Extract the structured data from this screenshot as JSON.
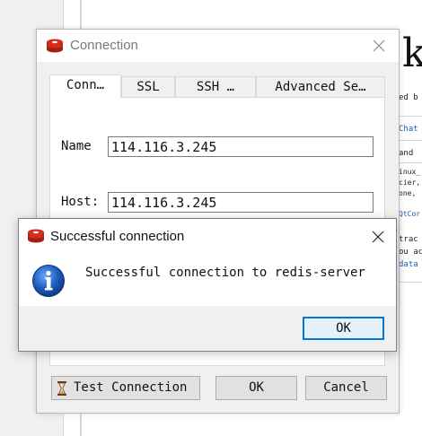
{
  "background": {
    "heading_fragment": "k",
    "lines": [
      {
        "text": "ed b",
        "link": false
      },
      {
        "text": "Chat",
        "link": true
      },
      {
        "text": " and",
        "link": false
      },
      {
        "text": "inux_",
        "link": false
      },
      {
        "text": "cier,",
        "link": false
      },
      {
        "text": "one,",
        "link": false
      },
      {
        "text": "QtCor",
        "link": true
      },
      {
        "text": "trac",
        "link": false
      },
      {
        "text": "ou ac",
        "link": false
      },
      {
        "text": "data",
        "link": true
      }
    ]
  },
  "connection_dialog": {
    "title": "Connection",
    "icon": "redis-icon",
    "tabs": [
      {
        "label": "Conn…",
        "active": true
      },
      {
        "label": "SSL",
        "active": false
      },
      {
        "label": "SSH …",
        "active": false
      },
      {
        "label": "Advanced Se…",
        "active": false
      }
    ],
    "fields": {
      "name_label": "Name",
      "name_value": "114.116.3.245",
      "host_label": "Host:",
      "host_value": "114.116.3.245"
    },
    "buttons": {
      "test_connection": "Test Connection",
      "ok": "OK",
      "cancel": "Cancel"
    }
  },
  "message_dialog": {
    "title": "Successful connection",
    "icon": "info-icon",
    "message": "Successful connection to redis-server",
    "ok_label": "OK"
  },
  "colors": {
    "accent_blue": "#0078d7",
    "redis_red": "#d82c20",
    "info_blue": "#1d5fbf"
  }
}
